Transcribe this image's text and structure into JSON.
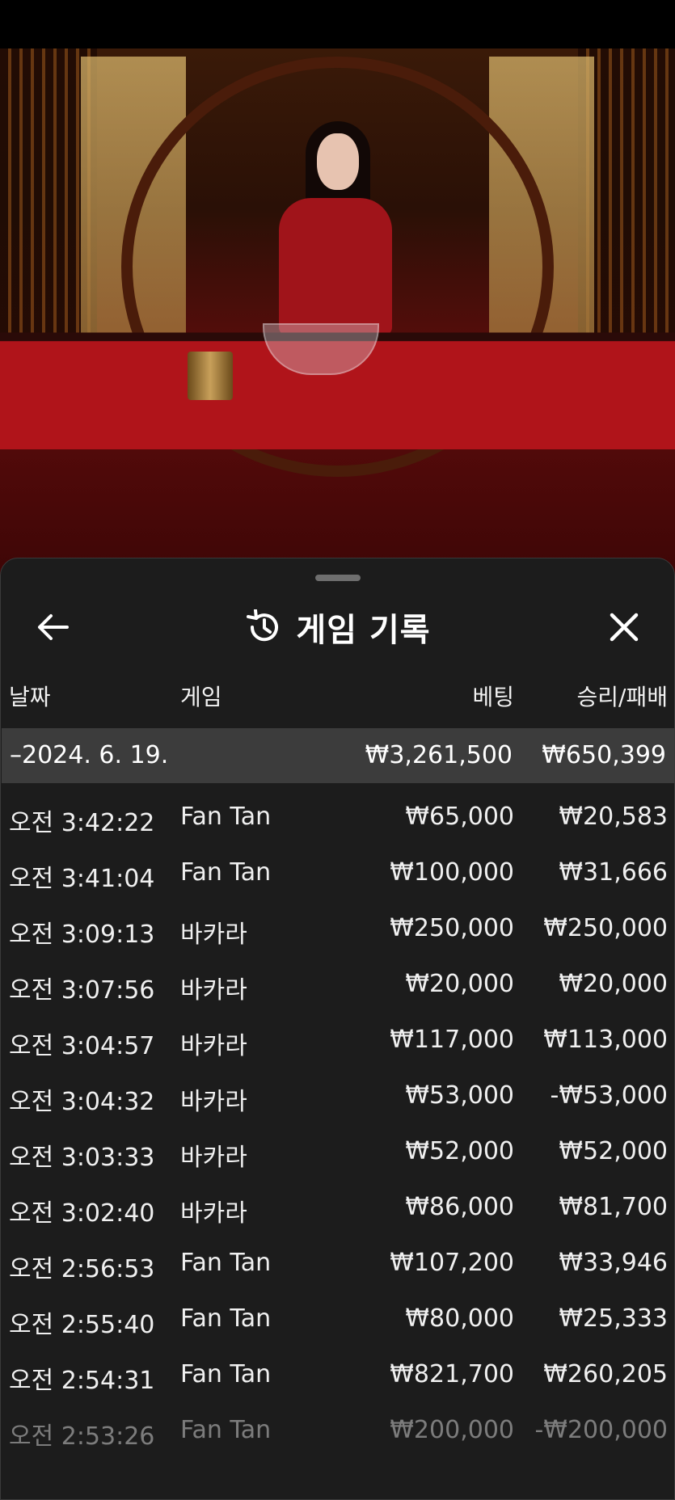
{
  "sheet": {
    "title": "게임 기록",
    "icons": {
      "back": "arrow-left-icon",
      "history": "history-icon",
      "close": "close-icon"
    }
  },
  "columns": {
    "date": "날짜",
    "game": "게임",
    "bet": "베팅",
    "win_loss": "승리/패배"
  },
  "summary": {
    "date": "–2024. 6. 19.",
    "bet": "₩3,261,500",
    "win_loss": "₩650,399"
  },
  "rows": [
    {
      "time": "오전 3:42:22",
      "game": "Fan Tan",
      "bet": "₩65,000",
      "win_loss": "₩20,583"
    },
    {
      "time": "오전 3:41:04",
      "game": "Fan Tan",
      "bet": "₩100,000",
      "win_loss": "₩31,666"
    },
    {
      "time": "오전 3:09:13",
      "game": "바카라",
      "bet": "₩250,000",
      "win_loss": "₩250,000"
    },
    {
      "time": "오전 3:07:56",
      "game": "바카라",
      "bet": "₩20,000",
      "win_loss": "₩20,000"
    },
    {
      "time": "오전 3:04:57",
      "game": "바카라",
      "bet": "₩117,000",
      "win_loss": "₩113,000"
    },
    {
      "time": "오전 3:04:32",
      "game": "바카라",
      "bet": "₩53,000",
      "win_loss": "-₩53,000"
    },
    {
      "time": "오전 3:03:33",
      "game": "바카라",
      "bet": "₩52,000",
      "win_loss": "₩52,000"
    },
    {
      "time": "오전 3:02:40",
      "game": "바카라",
      "bet": "₩86,000",
      "win_loss": "₩81,700"
    },
    {
      "time": "오전 2:56:53",
      "game": "Fan Tan",
      "bet": "₩107,200",
      "win_loss": "₩33,946"
    },
    {
      "time": "오전 2:55:40",
      "game": "Fan Tan",
      "bet": "₩80,000",
      "win_loss": "₩25,333"
    },
    {
      "time": "오전 2:54:31",
      "game": "Fan Tan",
      "bet": "₩821,700",
      "win_loss": "₩260,205"
    },
    {
      "time": "오전 2:53:26",
      "game": "Fan Tan",
      "bet": "₩200,000",
      "win_loss": "-₩200,000"
    }
  ],
  "colors": {
    "sheet_bg": "#1c1c1c",
    "summary_bg": "#3c3c3c",
    "text": "#ffffff"
  }
}
